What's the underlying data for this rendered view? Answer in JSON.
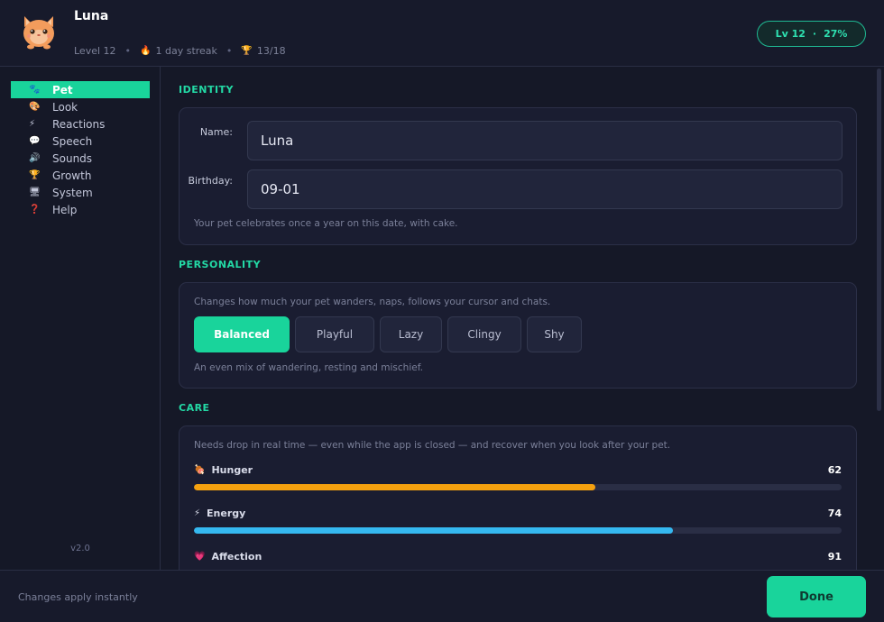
{
  "header": {
    "pet_name": "Luna",
    "level_text": "Level 12",
    "streak_icon": "fire-icon",
    "streak_text": "1 day streak",
    "trophy_icon": "trophy-icon",
    "achievements_text": "13/18",
    "level_pill_level": "Lv 12",
    "level_pill_sep": "·",
    "level_pill_progress": "27%"
  },
  "sidebar": {
    "items": [
      {
        "label": "Pet",
        "icon": "paw-icon",
        "glyph": "🐾",
        "active": true
      },
      {
        "label": "Look",
        "icon": "palette-icon",
        "glyph": "🎨",
        "active": false
      },
      {
        "label": "Reactions",
        "icon": "lightning-icon",
        "glyph": "⚡",
        "active": false
      },
      {
        "label": "Speech",
        "icon": "speech-bubble-icon",
        "glyph": "💬",
        "active": false
      },
      {
        "label": "Sounds",
        "icon": "speaker-icon",
        "glyph": "🔊",
        "active": false
      },
      {
        "label": "Growth",
        "icon": "trophy-icon",
        "glyph": "🏆",
        "active": false
      },
      {
        "label": "System",
        "icon": "monitor-icon",
        "glyph": "🖥",
        "active": false
      },
      {
        "label": "Help",
        "icon": "question-icon",
        "glyph": "❓",
        "active": false
      }
    ],
    "version": "v2.0"
  },
  "identity": {
    "title": "IDENTITY",
    "name_label": "Name:",
    "name_value": "Luna",
    "birthday_label": "Birthday:",
    "birthday_value": "09-01",
    "hint": "Your pet celebrates once a year on this date, with cake."
  },
  "personality": {
    "title": "PERSONALITY",
    "hint_top": "Changes how much your pet wanders, naps, follows your cursor and chats.",
    "options": [
      "Balanced",
      "Playful",
      "Lazy",
      "Clingy",
      "Shy"
    ],
    "selected": "Balanced",
    "hint_bottom": "An even mix of wandering, resting and mischief."
  },
  "care": {
    "title": "CARE",
    "hint": "Needs drop in real time — even while the app is closed — and recover when you look after your pet.",
    "stats": [
      {
        "label": "Hunger",
        "icon": "meat-icon",
        "glyph": "🍖",
        "value": 62,
        "display": "62",
        "color": "#f5a10f"
      },
      {
        "label": "Energy",
        "icon": "lightning-icon",
        "glyph": "⚡",
        "value": 74,
        "display": "74",
        "color": "#35b8f0"
      },
      {
        "label": "Affection",
        "icon": "heart-icon",
        "glyph": "💗",
        "value": 91,
        "display": "91",
        "color": "#f0436b"
      }
    ]
  },
  "footer": {
    "note": "Changes apply instantly",
    "done_label": "Done"
  },
  "colors": {
    "accent": "#19d49b",
    "background": "#151827",
    "card": "#1a1d31"
  }
}
